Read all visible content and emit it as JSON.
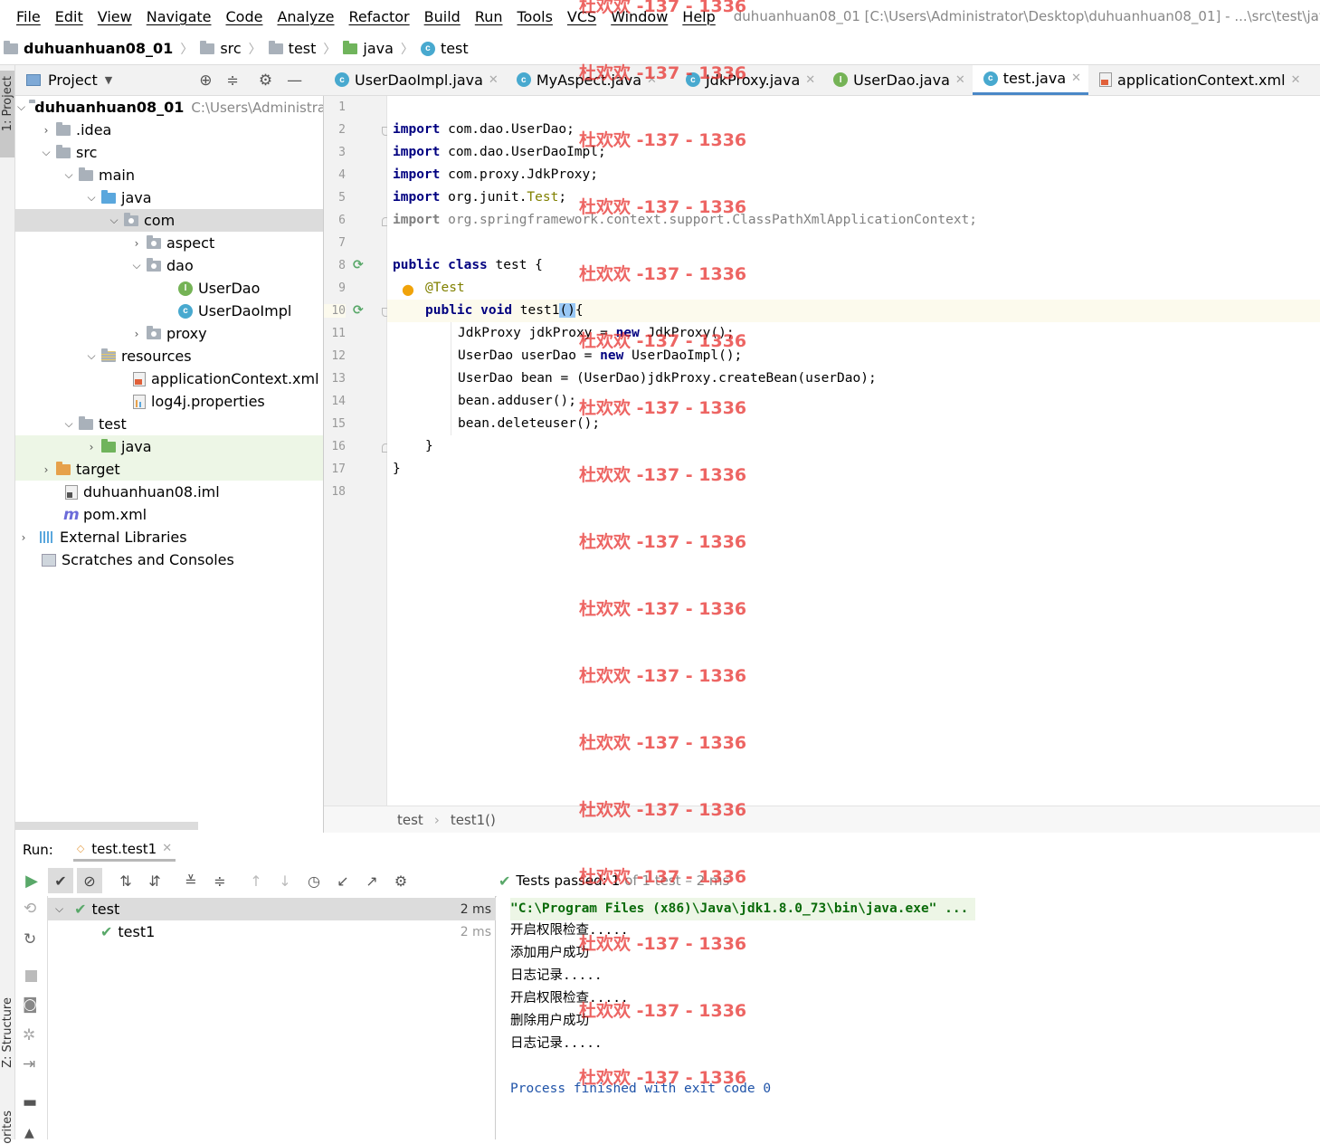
{
  "menubar": {
    "items": [
      "File",
      "Edit",
      "View",
      "Navigate",
      "Code",
      "Analyze",
      "Refactor",
      "Build",
      "Run",
      "Tools",
      "VCS",
      "Window",
      "Help"
    ],
    "window_title": "duhuanhuan08_01 [C:\\Users\\Administrator\\Desktop\\duhuanhuan08_01] - ...\\src\\test\\java\\test.j"
  },
  "breadcrumb": [
    "duhuanhuan08_01",
    "src",
    "test",
    "java",
    "test"
  ],
  "left_strip": {
    "project_label": "1: Project",
    "structure_label": "Z: Structure",
    "favorites_label": "orites"
  },
  "project_panel": {
    "title": "Project",
    "tree": [
      {
        "label": "duhuanhuan08_01",
        "extra": "C:\\Users\\Administra"
      },
      {
        "label": ".idea"
      },
      {
        "label": "src"
      },
      {
        "label": "main"
      },
      {
        "label": "java"
      },
      {
        "label": "com"
      },
      {
        "label": "aspect"
      },
      {
        "label": "dao"
      },
      {
        "label": "UserDao"
      },
      {
        "label": "UserDaoImpl"
      },
      {
        "label": "proxy"
      },
      {
        "label": "resources"
      },
      {
        "label": "applicationContext.xml"
      },
      {
        "label": "log4j.properties"
      },
      {
        "label": "test"
      },
      {
        "label": "java"
      },
      {
        "label": "target"
      },
      {
        "label": "duhuanhuan08.iml"
      },
      {
        "label": "pom.xml"
      },
      {
        "label": "External Libraries"
      },
      {
        "label": "Scratches and Consoles"
      }
    ]
  },
  "editor_tabs": [
    "UserDaoImpl.java",
    "MyAspect.java",
    "JdkProxy.java",
    "UserDao.java",
    "test.java",
    "applicationContext.xml"
  ],
  "code": {
    "line_numbers": [
      "1",
      "2",
      "3",
      "4",
      "5",
      "6",
      "7",
      "8",
      "9",
      "10",
      "11",
      "12",
      "13",
      "14",
      "15",
      "16",
      "17",
      "18"
    ],
    "kw_import": "import",
    "kw_public": "public",
    "kw_class": "class",
    "kw_void": "void",
    "kw_new": "new",
    "l2": " com.dao.UserDao;",
    "l3": " com.dao.UserDaoImpl;",
    "l4": " com.proxy.JdkProxy;",
    "l5a": " org.junit.",
    "l5b": "Test",
    "l5c": ";",
    "l6": " org.springframework.context.support.ClassPathXmlApplicationContext;",
    "l8": " test {",
    "l9": "@Test",
    "l10a": " test1",
    "l10b": "()",
    "l10c": "{",
    "l11a": "JdkProxy jdkProxy = ",
    "l11b": " JdkProxy();",
    "l12a": "UserDao userDao = ",
    "l12b": " UserDaoImpl();",
    "l13": "UserDao bean = (UserDao)jdkProxy.createBean(userDao);",
    "l14": "bean.adduser();",
    "l15": "bean.deleteuser();",
    "l16": "}",
    "l17": "}"
  },
  "editor_breadcrumb": [
    "test",
    "test1()"
  ],
  "run": {
    "label": "Run:",
    "tab": "test.test1",
    "status_passed": "Tests passed:",
    "status_count": "1",
    "status_rest": "of 1 test – 2 ms",
    "tree": [
      {
        "label": "test",
        "time": "2 ms"
      },
      {
        "label": "test1",
        "time": "2 ms"
      }
    ],
    "console": [
      "\"C:\\Program Files (x86)\\Java\\jdk1.8.0_73\\bin\\java.exe\" ...",
      "开启权限检查.....",
      "添加用户成功",
      "日志记录.....",
      "开启权限检查.....",
      "删除用户成功",
      "日志记录.....",
      "",
      "Process finished with exit code 0"
    ]
  },
  "watermark": "杜欢欢 -137 - 1336",
  "colors": {
    "keyword": "#000080",
    "annotation": "#808000",
    "accent": "#4a88c7",
    "pass": "#59a869",
    "process": "#1f53a8",
    "watermark": "#e8322f"
  }
}
